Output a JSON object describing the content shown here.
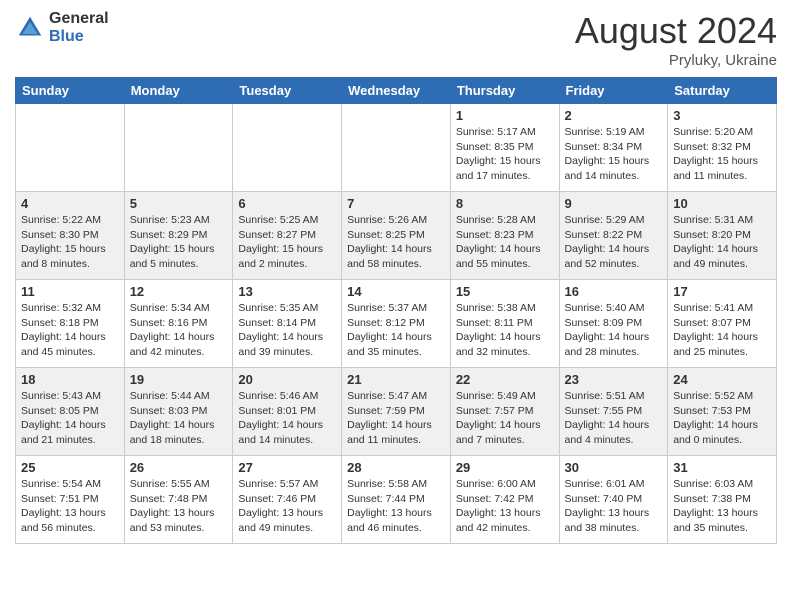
{
  "header": {
    "logo": {
      "line1": "General",
      "line2": "Blue"
    },
    "title": "August 2024",
    "location": "Pryluky, Ukraine"
  },
  "weekdays": [
    "Sunday",
    "Monday",
    "Tuesday",
    "Wednesday",
    "Thursday",
    "Friday",
    "Saturday"
  ],
  "weeks": [
    [
      null,
      null,
      null,
      null,
      {
        "day": "1",
        "sunrise": "5:17 AM",
        "sunset": "8:35 PM",
        "daylight": "15 hours and 17 minutes."
      },
      {
        "day": "2",
        "sunrise": "5:19 AM",
        "sunset": "8:34 PM",
        "daylight": "15 hours and 14 minutes."
      },
      {
        "day": "3",
        "sunrise": "5:20 AM",
        "sunset": "8:32 PM",
        "daylight": "15 hours and 11 minutes."
      }
    ],
    [
      {
        "day": "4",
        "sunrise": "5:22 AM",
        "sunset": "8:30 PM",
        "daylight": "15 hours and 8 minutes."
      },
      {
        "day": "5",
        "sunrise": "5:23 AM",
        "sunset": "8:29 PM",
        "daylight": "15 hours and 5 minutes."
      },
      {
        "day": "6",
        "sunrise": "5:25 AM",
        "sunset": "8:27 PM",
        "daylight": "15 hours and 2 minutes."
      },
      {
        "day": "7",
        "sunrise": "5:26 AM",
        "sunset": "8:25 PM",
        "daylight": "14 hours and 58 minutes."
      },
      {
        "day": "8",
        "sunrise": "5:28 AM",
        "sunset": "8:23 PM",
        "daylight": "14 hours and 55 minutes."
      },
      {
        "day": "9",
        "sunrise": "5:29 AM",
        "sunset": "8:22 PM",
        "daylight": "14 hours and 52 minutes."
      },
      {
        "day": "10",
        "sunrise": "5:31 AM",
        "sunset": "8:20 PM",
        "daylight": "14 hours and 49 minutes."
      }
    ],
    [
      {
        "day": "11",
        "sunrise": "5:32 AM",
        "sunset": "8:18 PM",
        "daylight": "14 hours and 45 minutes."
      },
      {
        "day": "12",
        "sunrise": "5:34 AM",
        "sunset": "8:16 PM",
        "daylight": "14 hours and 42 minutes."
      },
      {
        "day": "13",
        "sunrise": "5:35 AM",
        "sunset": "8:14 PM",
        "daylight": "14 hours and 39 minutes."
      },
      {
        "day": "14",
        "sunrise": "5:37 AM",
        "sunset": "8:12 PM",
        "daylight": "14 hours and 35 minutes."
      },
      {
        "day": "15",
        "sunrise": "5:38 AM",
        "sunset": "8:11 PM",
        "daylight": "14 hours and 32 minutes."
      },
      {
        "day": "16",
        "sunrise": "5:40 AM",
        "sunset": "8:09 PM",
        "daylight": "14 hours and 28 minutes."
      },
      {
        "day": "17",
        "sunrise": "5:41 AM",
        "sunset": "8:07 PM",
        "daylight": "14 hours and 25 minutes."
      }
    ],
    [
      {
        "day": "18",
        "sunrise": "5:43 AM",
        "sunset": "8:05 PM",
        "daylight": "14 hours and 21 minutes."
      },
      {
        "day": "19",
        "sunrise": "5:44 AM",
        "sunset": "8:03 PM",
        "daylight": "14 hours and 18 minutes."
      },
      {
        "day": "20",
        "sunrise": "5:46 AM",
        "sunset": "8:01 PM",
        "daylight": "14 hours and 14 minutes."
      },
      {
        "day": "21",
        "sunrise": "5:47 AM",
        "sunset": "7:59 PM",
        "daylight": "14 hours and 11 minutes."
      },
      {
        "day": "22",
        "sunrise": "5:49 AM",
        "sunset": "7:57 PM",
        "daylight": "14 hours and 7 minutes."
      },
      {
        "day": "23",
        "sunrise": "5:51 AM",
        "sunset": "7:55 PM",
        "daylight": "14 hours and 4 minutes."
      },
      {
        "day": "24",
        "sunrise": "5:52 AM",
        "sunset": "7:53 PM",
        "daylight": "14 hours and 0 minutes."
      }
    ],
    [
      {
        "day": "25",
        "sunrise": "5:54 AM",
        "sunset": "7:51 PM",
        "daylight": "13 hours and 56 minutes."
      },
      {
        "day": "26",
        "sunrise": "5:55 AM",
        "sunset": "7:48 PM",
        "daylight": "13 hours and 53 minutes."
      },
      {
        "day": "27",
        "sunrise": "5:57 AM",
        "sunset": "7:46 PM",
        "daylight": "13 hours and 49 minutes."
      },
      {
        "day": "28",
        "sunrise": "5:58 AM",
        "sunset": "7:44 PM",
        "daylight": "13 hours and 46 minutes."
      },
      {
        "day": "29",
        "sunrise": "6:00 AM",
        "sunset": "7:42 PM",
        "daylight": "13 hours and 42 minutes."
      },
      {
        "day": "30",
        "sunrise": "6:01 AM",
        "sunset": "7:40 PM",
        "daylight": "13 hours and 38 minutes."
      },
      {
        "day": "31",
        "sunrise": "6:03 AM",
        "sunset": "7:38 PM",
        "daylight": "13 hours and 35 minutes."
      }
    ]
  ]
}
